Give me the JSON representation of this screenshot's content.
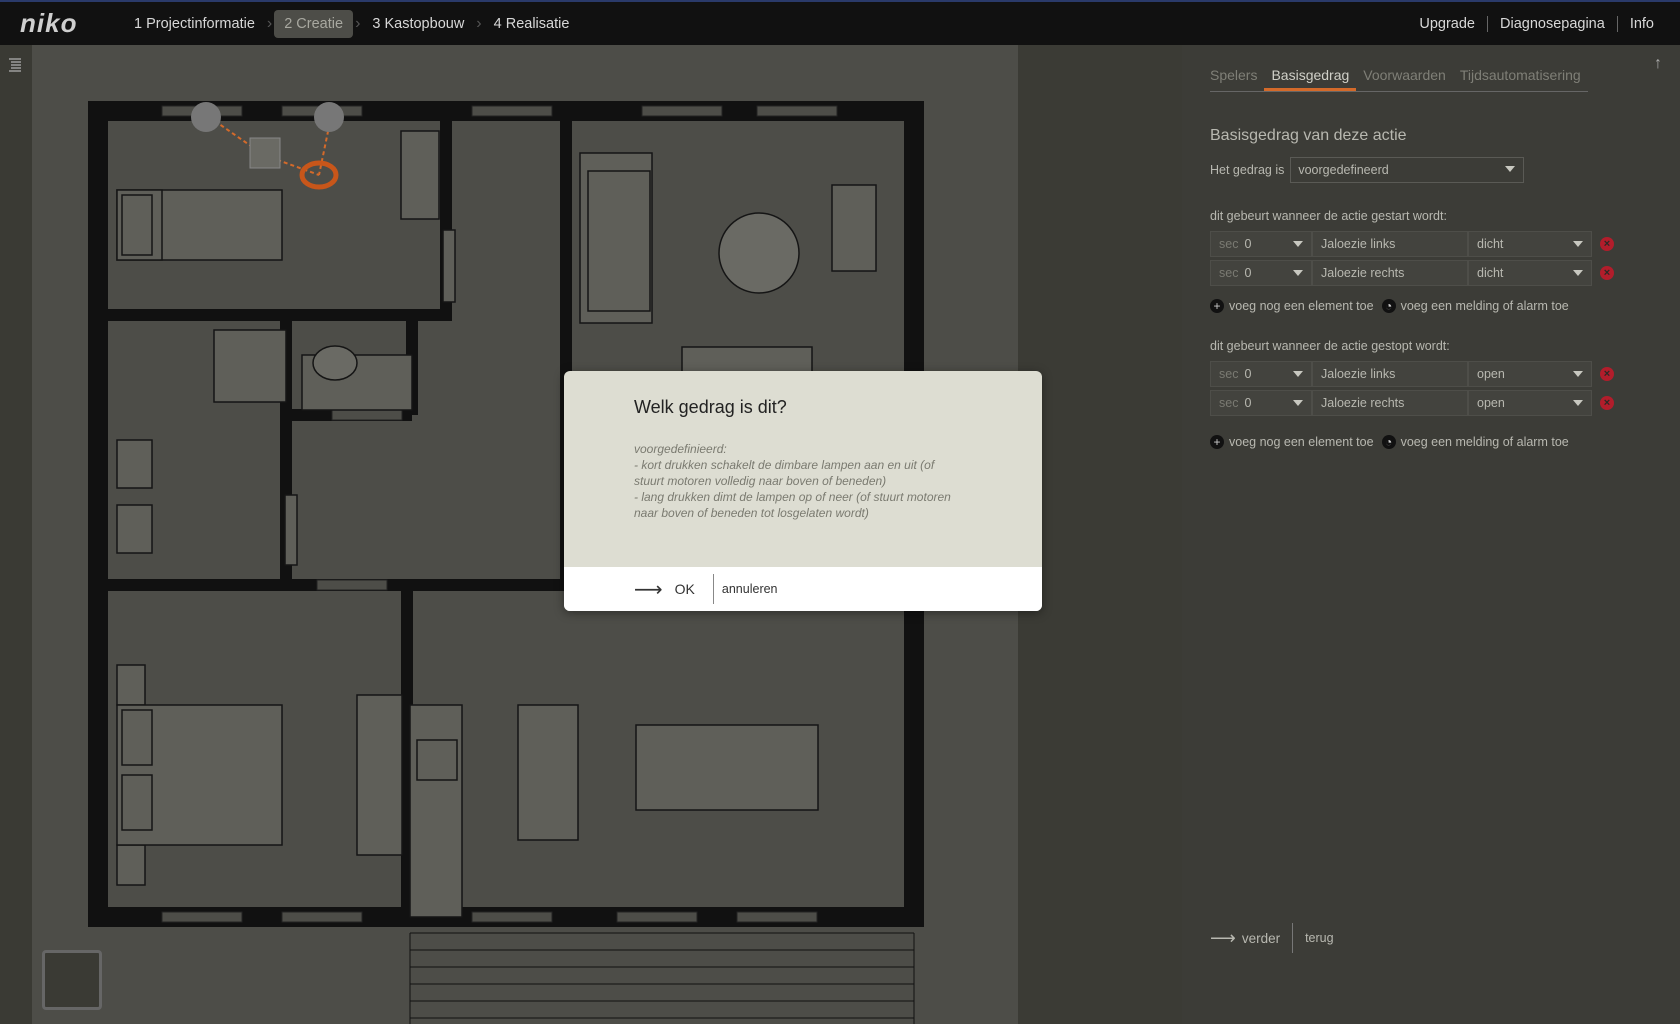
{
  "topbar": {
    "logo": "niko",
    "steps": [
      {
        "label": "1 Projectinformatie"
      },
      {
        "label": "2 Creatie"
      },
      {
        "label": "3 Kastopbouw"
      },
      {
        "label": "4 Realisatie"
      }
    ],
    "links": [
      "Upgrade",
      "Diagnosepagina",
      "Info"
    ]
  },
  "panel": {
    "tabs": [
      "Spelers",
      "Basisgedrag",
      "Voorwaarden",
      "Tijdsautomatisering"
    ],
    "active_tab": "Basisgedrag",
    "section_title": "Basisgedrag van deze actie",
    "behaviour_label": "Het gedrag is",
    "behaviour_value": "voorgedefineerd",
    "start_title": "dit gebeurt wanneer de actie gestart wordt:",
    "start_rows": [
      {
        "unit": "sec",
        "delay": "0",
        "element": "Jaloezie links",
        "state": "dicht"
      },
      {
        "unit": "sec",
        "delay": "0",
        "element": "Jaloezie rechts",
        "state": "dicht"
      }
    ],
    "stop_title": "dit gebeurt wanneer de actie gestopt wordt:",
    "stop_rows": [
      {
        "unit": "sec",
        "delay": "0",
        "element": "Jaloezie links",
        "state": "open"
      },
      {
        "unit": "sec",
        "delay": "0",
        "element": "Jaloezie rechts",
        "state": "open"
      }
    ],
    "add_element": "voeg nog een element toe",
    "add_alarm": "voeg een melding of alarm toe",
    "next": "verder",
    "back": "terug"
  },
  "dialog": {
    "title": "Welk gedrag is dit?",
    "body": "voorgedefinieerd:\n- kort drukken schakelt de dimbare lampen aan en uit (of stuurt motoren volledig naar boven of beneden)\n- lang drukken dimt de lampen op of neer (of stuurt motoren naar boven of beneden tot losgelaten wordt)",
    "ok": "OK",
    "cancel": "annuleren"
  },
  "colors": {
    "accent": "#d46a2a",
    "delete": "#b21d2b",
    "dialog_bg": "#ddddd2"
  }
}
